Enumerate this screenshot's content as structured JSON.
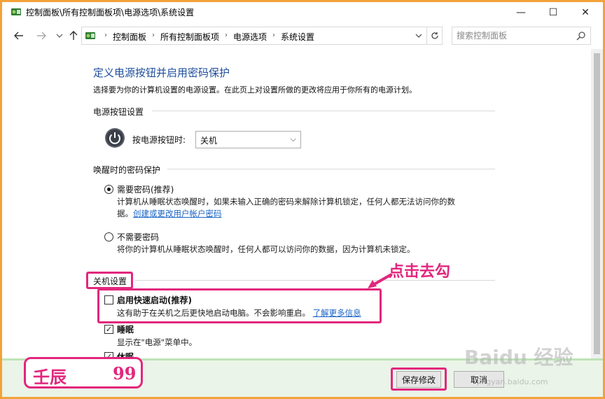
{
  "window": {
    "title": "控制面板\\所有控制面板项\\电源选项\\系统设置",
    "minimize_glyph": "—",
    "maximize_glyph": "☐",
    "close_glyph": "✕"
  },
  "nav": {
    "back_icon": "arrow-left-icon",
    "forward_icon": "arrow-right-icon",
    "up_icon": "arrow-up-icon"
  },
  "address": {
    "crumbs": [
      "控制面板",
      "所有控制面板项",
      "电源选项",
      "系统设置"
    ],
    "separator": "›"
  },
  "search": {
    "placeholder": "搜索控制面板"
  },
  "page": {
    "heading": "定义电源按钮并启用密码保护",
    "description": "选择要为你的计算机设置的电源设置。在此页上对设置所做的更改将应用于你所有的电源计划。"
  },
  "power_buttons": {
    "section_title": "电源按钮设置",
    "label": "按电源按钮时:",
    "selected": "关机"
  },
  "wake_password": {
    "section_title": "唤醒时的密码保护",
    "require": {
      "label": "需要密码(推荐)",
      "desc_line1": "计算机从睡眠状态唤醒时，如果未输入正确的密码来解除计算机锁定，任何人都无法访问你的数",
      "desc_line2_prefix": "据。",
      "link": "创建或更改用户帐户密码",
      "checked": true
    },
    "no_require": {
      "label": "不需要密码",
      "desc": "将你的计算机从睡眠状态唤醒时，任何人都可以访问你的数据，因为计算机未锁定。",
      "checked": false
    }
  },
  "shutdown": {
    "section_title": "关机设置",
    "fast_startup": {
      "label": "启用快速启动(推荐)",
      "desc": "这有助于在关机之后更快地启动电脑。不会影响重启。",
      "link": "了解更多信息",
      "checked": false
    },
    "sleep": {
      "label": "睡眠",
      "desc": "显示在\"电源\"菜单中。",
      "checked": true
    },
    "hibernate": {
      "label": "休眠",
      "checked": true
    }
  },
  "annotation": {
    "callout": "点击去勾",
    "stamp_left": "壬辰",
    "stamp_right": "99",
    "color": "#e2277d"
  },
  "buttons": {
    "save": "保存修改",
    "cancel": "取消"
  },
  "watermark": {
    "main": "Baidu 经验",
    "sub": "jingyan.baidu.com"
  },
  "colors": {
    "frame_border": "#f3a23a",
    "heading": "#1e4e9b",
    "link": "#1a63c7",
    "highlight": "#e2277d"
  }
}
